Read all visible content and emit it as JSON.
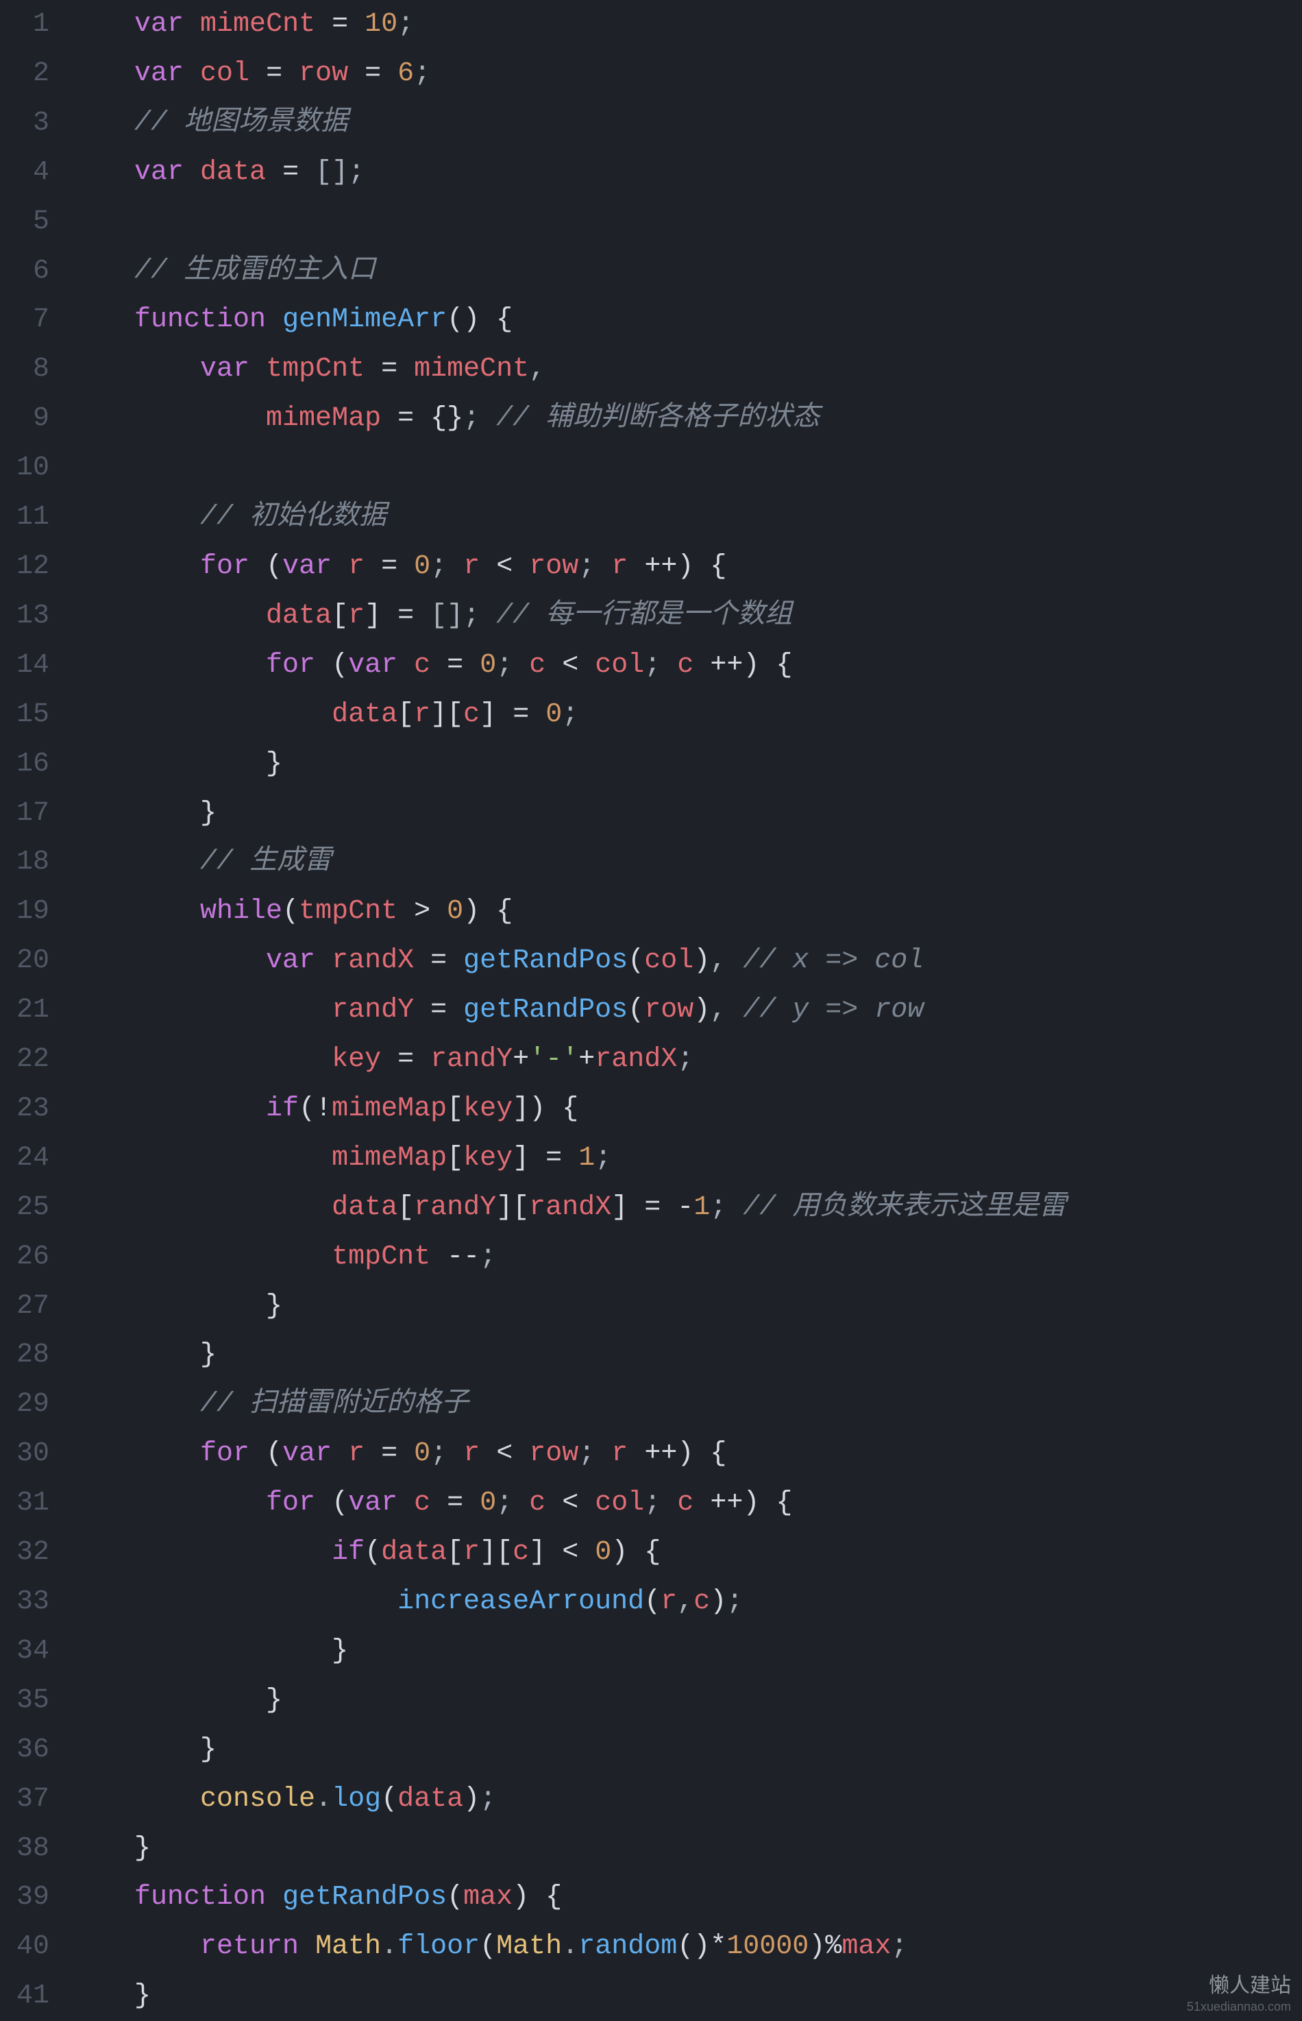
{
  "theme": {
    "background": "#1e2127",
    "foreground": "#abb2bf",
    "lineNumber": "#515765",
    "keyword": "#c678dd",
    "function": "#61afef",
    "identifier": "#e06c75",
    "classLike": "#e5c07b",
    "number": "#d19a66",
    "string": "#98c379",
    "comment": "#7c8592"
  },
  "watermark": {
    "line1": "懒人建站",
    "line2": "51xuediannao.com"
  },
  "lineCount": 41,
  "code": {
    "lines": [
      [
        [
          "kw",
          "var"
        ],
        [
          "pn",
          " "
        ],
        [
          "id",
          "mimeCnt"
        ],
        [
          "pn",
          " "
        ],
        [
          "light",
          "="
        ],
        [
          "pn",
          " "
        ],
        [
          "num",
          "10"
        ],
        [
          "pn",
          ";"
        ]
      ],
      [
        [
          "kw",
          "var"
        ],
        [
          "pn",
          " "
        ],
        [
          "id",
          "col"
        ],
        [
          "pn",
          " "
        ],
        [
          "light",
          "="
        ],
        [
          "pn",
          " "
        ],
        [
          "id",
          "row"
        ],
        [
          "pn",
          " "
        ],
        [
          "light",
          "="
        ],
        [
          "pn",
          " "
        ],
        [
          "num",
          "6"
        ],
        [
          "pn",
          ";"
        ]
      ],
      [
        [
          "cm",
          "// 地图场景数据"
        ]
      ],
      [
        [
          "kw",
          "var"
        ],
        [
          "pn",
          " "
        ],
        [
          "id",
          "data"
        ],
        [
          "pn",
          " "
        ],
        [
          "light",
          "="
        ],
        [
          "pn",
          " [];"
        ]
      ],
      [],
      [
        [
          "cm",
          "// 生成雷的主入口"
        ]
      ],
      [
        [
          "kw",
          "function"
        ],
        [
          "pn",
          " "
        ],
        [
          "fn",
          "genMimeArr"
        ],
        [
          "light",
          "()"
        ],
        [
          "pn",
          " "
        ],
        [
          "light",
          "{"
        ]
      ],
      [
        [
          "pn",
          "    "
        ],
        [
          "kw",
          "var"
        ],
        [
          "pn",
          " "
        ],
        [
          "id",
          "tmpCnt"
        ],
        [
          "pn",
          " "
        ],
        [
          "light",
          "="
        ],
        [
          "pn",
          " "
        ],
        [
          "id",
          "mimeCnt"
        ],
        [
          "pn",
          ","
        ]
      ],
      [
        [
          "pn",
          "        "
        ],
        [
          "id",
          "mimeMap"
        ],
        [
          "pn",
          " "
        ],
        [
          "light",
          "="
        ],
        [
          "pn",
          " "
        ],
        [
          "light",
          "{}"
        ],
        [
          "pn",
          "; "
        ],
        [
          "cm",
          "// 辅助判断各格子的状态"
        ]
      ],
      [],
      [
        [
          "pn",
          "    "
        ],
        [
          "cm",
          "// 初始化数据"
        ]
      ],
      [
        [
          "pn",
          "    "
        ],
        [
          "kw",
          "for"
        ],
        [
          "pn",
          " "
        ],
        [
          "light",
          "("
        ],
        [
          "kw",
          "var"
        ],
        [
          "pn",
          " "
        ],
        [
          "id",
          "r"
        ],
        [
          "pn",
          " "
        ],
        [
          "light",
          "="
        ],
        [
          "pn",
          " "
        ],
        [
          "num",
          "0"
        ],
        [
          "pn",
          "; "
        ],
        [
          "id",
          "r"
        ],
        [
          "pn",
          " "
        ],
        [
          "light",
          "<"
        ],
        [
          "pn",
          " "
        ],
        [
          "id",
          "row"
        ],
        [
          "pn",
          "; "
        ],
        [
          "id",
          "r"
        ],
        [
          "pn",
          " "
        ],
        [
          "light",
          "++"
        ],
        [
          "light",
          ")"
        ],
        [
          "pn",
          " "
        ],
        [
          "light",
          "{"
        ]
      ],
      [
        [
          "pn",
          "        "
        ],
        [
          "id",
          "data"
        ],
        [
          "light",
          "["
        ],
        [
          "id",
          "r"
        ],
        [
          "light",
          "]"
        ],
        [
          "pn",
          " "
        ],
        [
          "light",
          "="
        ],
        [
          "pn",
          " []; "
        ],
        [
          "cm",
          "// 每一行都是一个数组"
        ]
      ],
      [
        [
          "pn",
          "        "
        ],
        [
          "kw",
          "for"
        ],
        [
          "pn",
          " "
        ],
        [
          "light",
          "("
        ],
        [
          "kw",
          "var"
        ],
        [
          "pn",
          " "
        ],
        [
          "id",
          "c"
        ],
        [
          "pn",
          " "
        ],
        [
          "light",
          "="
        ],
        [
          "pn",
          " "
        ],
        [
          "num",
          "0"
        ],
        [
          "pn",
          "; "
        ],
        [
          "id",
          "c"
        ],
        [
          "pn",
          " "
        ],
        [
          "light",
          "<"
        ],
        [
          "pn",
          " "
        ],
        [
          "id",
          "col"
        ],
        [
          "pn",
          "; "
        ],
        [
          "id",
          "c"
        ],
        [
          "pn",
          " "
        ],
        [
          "light",
          "++"
        ],
        [
          "light",
          ")"
        ],
        [
          "pn",
          " "
        ],
        [
          "light",
          "{"
        ]
      ],
      [
        [
          "pn",
          "            "
        ],
        [
          "id",
          "data"
        ],
        [
          "light",
          "["
        ],
        [
          "id",
          "r"
        ],
        [
          "light",
          "]"
        ],
        [
          "light",
          "["
        ],
        [
          "id",
          "c"
        ],
        [
          "light",
          "]"
        ],
        [
          "pn",
          " "
        ],
        [
          "light",
          "="
        ],
        [
          "pn",
          " "
        ],
        [
          "num",
          "0"
        ],
        [
          "pn",
          ";"
        ]
      ],
      [
        [
          "pn",
          "        "
        ],
        [
          "light",
          "}"
        ]
      ],
      [
        [
          "pn",
          "    "
        ],
        [
          "light",
          "}"
        ]
      ],
      [
        [
          "pn",
          "    "
        ],
        [
          "cm",
          "// 生成雷"
        ]
      ],
      [
        [
          "pn",
          "    "
        ],
        [
          "kw",
          "while"
        ],
        [
          "light",
          "("
        ],
        [
          "id",
          "tmpCnt"
        ],
        [
          "pn",
          " "
        ],
        [
          "light",
          ">"
        ],
        [
          "pn",
          " "
        ],
        [
          "num",
          "0"
        ],
        [
          "light",
          ")"
        ],
        [
          "pn",
          " "
        ],
        [
          "light",
          "{"
        ]
      ],
      [
        [
          "pn",
          "        "
        ],
        [
          "kw",
          "var"
        ],
        [
          "pn",
          " "
        ],
        [
          "id",
          "randX"
        ],
        [
          "pn",
          " "
        ],
        [
          "light",
          "="
        ],
        [
          "pn",
          " "
        ],
        [
          "fn",
          "getRandPos"
        ],
        [
          "light",
          "("
        ],
        [
          "id",
          "col"
        ],
        [
          "light",
          ")"
        ],
        [
          "pn",
          ", "
        ],
        [
          "cm",
          "// x => col"
        ]
      ],
      [
        [
          "pn",
          "            "
        ],
        [
          "id",
          "randY"
        ],
        [
          "pn",
          " "
        ],
        [
          "light",
          "="
        ],
        [
          "pn",
          " "
        ],
        [
          "fn",
          "getRandPos"
        ],
        [
          "light",
          "("
        ],
        [
          "id",
          "row"
        ],
        [
          "light",
          ")"
        ],
        [
          "pn",
          ", "
        ],
        [
          "cm",
          "// y => row"
        ]
      ],
      [
        [
          "pn",
          "            "
        ],
        [
          "id",
          "key"
        ],
        [
          "pn",
          " "
        ],
        [
          "light",
          "="
        ],
        [
          "pn",
          " "
        ],
        [
          "id",
          "randY"
        ],
        [
          "light",
          "+"
        ],
        [
          "str",
          "'-'"
        ],
        [
          "light",
          "+"
        ],
        [
          "id",
          "randX"
        ],
        [
          "pn",
          ";"
        ]
      ],
      [
        [
          "pn",
          "        "
        ],
        [
          "kw",
          "if"
        ],
        [
          "light",
          "("
        ],
        [
          "light",
          "!"
        ],
        [
          "id",
          "mimeMap"
        ],
        [
          "light",
          "["
        ],
        [
          "id",
          "key"
        ],
        [
          "light",
          "]"
        ],
        [
          "light",
          ")"
        ],
        [
          "pn",
          " "
        ],
        [
          "light",
          "{"
        ]
      ],
      [
        [
          "pn",
          "            "
        ],
        [
          "id",
          "mimeMap"
        ],
        [
          "light",
          "["
        ],
        [
          "id",
          "key"
        ],
        [
          "light",
          "]"
        ],
        [
          "pn",
          " "
        ],
        [
          "light",
          "="
        ],
        [
          "pn",
          " "
        ],
        [
          "num",
          "1"
        ],
        [
          "pn",
          ";"
        ]
      ],
      [
        [
          "pn",
          "            "
        ],
        [
          "id",
          "data"
        ],
        [
          "light",
          "["
        ],
        [
          "id",
          "randY"
        ],
        [
          "light",
          "]"
        ],
        [
          "light",
          "["
        ],
        [
          "id",
          "randX"
        ],
        [
          "light",
          "]"
        ],
        [
          "pn",
          " "
        ],
        [
          "light",
          "="
        ],
        [
          "pn",
          " "
        ],
        [
          "light",
          "-"
        ],
        [
          "num",
          "1"
        ],
        [
          "pn",
          "; "
        ],
        [
          "cm",
          "// 用负数来表示这里是雷"
        ]
      ],
      [
        [
          "pn",
          "            "
        ],
        [
          "id",
          "tmpCnt"
        ],
        [
          "pn",
          " "
        ],
        [
          "light",
          "--"
        ],
        [
          "pn",
          ";"
        ]
      ],
      [
        [
          "pn",
          "        "
        ],
        [
          "light",
          "}"
        ]
      ],
      [
        [
          "pn",
          "    "
        ],
        [
          "light",
          "}"
        ]
      ],
      [
        [
          "pn",
          "    "
        ],
        [
          "cm",
          "// 扫描雷附近的格子"
        ]
      ],
      [
        [
          "pn",
          "    "
        ],
        [
          "kw",
          "for"
        ],
        [
          "pn",
          " "
        ],
        [
          "light",
          "("
        ],
        [
          "kw",
          "var"
        ],
        [
          "pn",
          " "
        ],
        [
          "id",
          "r"
        ],
        [
          "pn",
          " "
        ],
        [
          "light",
          "="
        ],
        [
          "pn",
          " "
        ],
        [
          "num",
          "0"
        ],
        [
          "pn",
          "; "
        ],
        [
          "id",
          "r"
        ],
        [
          "pn",
          " "
        ],
        [
          "light",
          "<"
        ],
        [
          "pn",
          " "
        ],
        [
          "id",
          "row"
        ],
        [
          "pn",
          "; "
        ],
        [
          "id",
          "r"
        ],
        [
          "pn",
          " "
        ],
        [
          "light",
          "++"
        ],
        [
          "light",
          ")"
        ],
        [
          "pn",
          " "
        ],
        [
          "light",
          "{"
        ]
      ],
      [
        [
          "pn",
          "        "
        ],
        [
          "kw",
          "for"
        ],
        [
          "pn",
          " "
        ],
        [
          "light",
          "("
        ],
        [
          "kw",
          "var"
        ],
        [
          "pn",
          " "
        ],
        [
          "id",
          "c"
        ],
        [
          "pn",
          " "
        ],
        [
          "light",
          "="
        ],
        [
          "pn",
          " "
        ],
        [
          "num",
          "0"
        ],
        [
          "pn",
          "; "
        ],
        [
          "id",
          "c"
        ],
        [
          "pn",
          " "
        ],
        [
          "light",
          "<"
        ],
        [
          "pn",
          " "
        ],
        [
          "id",
          "col"
        ],
        [
          "pn",
          "; "
        ],
        [
          "id",
          "c"
        ],
        [
          "pn",
          " "
        ],
        [
          "light",
          "++"
        ],
        [
          "light",
          ")"
        ],
        [
          "pn",
          " "
        ],
        [
          "light",
          "{"
        ]
      ],
      [
        [
          "pn",
          "            "
        ],
        [
          "kw",
          "if"
        ],
        [
          "light",
          "("
        ],
        [
          "id",
          "data"
        ],
        [
          "light",
          "["
        ],
        [
          "id",
          "r"
        ],
        [
          "light",
          "]"
        ],
        [
          "light",
          "["
        ],
        [
          "id",
          "c"
        ],
        [
          "light",
          "]"
        ],
        [
          "pn",
          " "
        ],
        [
          "light",
          "<"
        ],
        [
          "pn",
          " "
        ],
        [
          "num",
          "0"
        ],
        [
          "light",
          ")"
        ],
        [
          "pn",
          " "
        ],
        [
          "light",
          "{"
        ]
      ],
      [
        [
          "pn",
          "                "
        ],
        [
          "fn",
          "increaseArround"
        ],
        [
          "light",
          "("
        ],
        [
          "id",
          "r"
        ],
        [
          "pn",
          ","
        ],
        [
          "id",
          "c"
        ],
        [
          "light",
          ")"
        ],
        [
          "pn",
          ";"
        ]
      ],
      [
        [
          "pn",
          "            "
        ],
        [
          "light",
          "}"
        ]
      ],
      [
        [
          "pn",
          "        "
        ],
        [
          "light",
          "}"
        ]
      ],
      [
        [
          "pn",
          "    "
        ],
        [
          "light",
          "}"
        ]
      ],
      [
        [
          "pn",
          "    "
        ],
        [
          "obj",
          "console"
        ],
        [
          "pn",
          "."
        ],
        [
          "fn",
          "log"
        ],
        [
          "light",
          "("
        ],
        [
          "id",
          "data"
        ],
        [
          "light",
          ")"
        ],
        [
          "pn",
          ";"
        ]
      ],
      [
        [
          "light",
          "}"
        ]
      ],
      [
        [
          "kw",
          "function"
        ],
        [
          "pn",
          " "
        ],
        [
          "fn",
          "getRandPos"
        ],
        [
          "light",
          "("
        ],
        [
          "id",
          "max"
        ],
        [
          "light",
          ")"
        ],
        [
          "pn",
          " "
        ],
        [
          "light",
          "{"
        ]
      ],
      [
        [
          "pn",
          "    "
        ],
        [
          "kw",
          "return"
        ],
        [
          "pn",
          " "
        ],
        [
          "obj",
          "Math"
        ],
        [
          "pn",
          "."
        ],
        [
          "fn",
          "floor"
        ],
        [
          "light",
          "("
        ],
        [
          "obj",
          "Math"
        ],
        [
          "pn",
          "."
        ],
        [
          "fn",
          "random"
        ],
        [
          "light",
          "()"
        ],
        [
          "light",
          "*"
        ],
        [
          "num",
          "10000"
        ],
        [
          "light",
          ")"
        ],
        [
          "light",
          "%"
        ],
        [
          "id",
          "max"
        ],
        [
          "pn",
          ";"
        ]
      ],
      [
        [
          "light",
          "}"
        ]
      ]
    ]
  }
}
